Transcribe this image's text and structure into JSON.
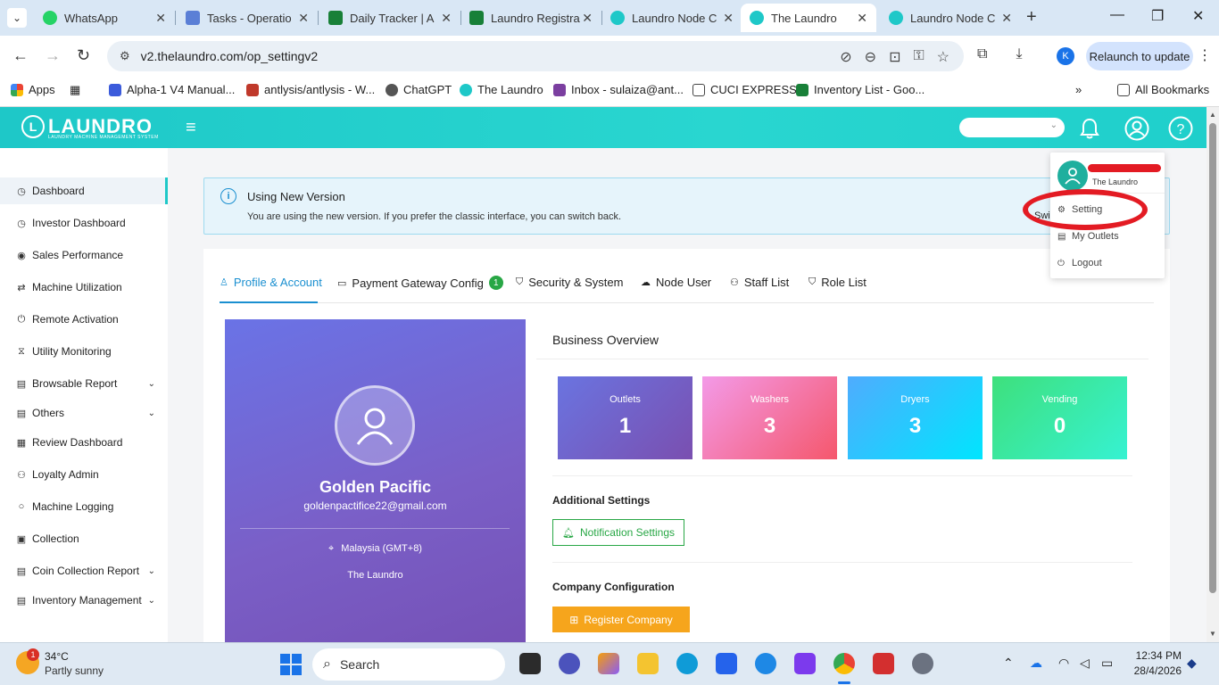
{
  "browser": {
    "tabs": [
      {
        "title": "WhatsApp",
        "color": "#25d366"
      },
      {
        "title": "Tasks - Operatio",
        "color": "#5b7fd6"
      },
      {
        "title": "Daily Tracker | A",
        "color": "#188038"
      },
      {
        "title": "Laundro Registra",
        "color": "#188038"
      },
      {
        "title": "Laundro Node C",
        "color": "#1ec8c8"
      },
      {
        "title": "The Laundro",
        "color": "#1ec8c8"
      },
      {
        "title": "Laundro Node C",
        "color": "#1ec8c8"
      }
    ],
    "url": "v2.thelaundro.com/op_settingv2",
    "relaunch_label": "Relaunch to update",
    "profile_letter": "K",
    "bookmarks": [
      {
        "label": "Apps"
      },
      {
        "label": "Alpha-1 V4 Manual..."
      },
      {
        "label": "antlysis/antlysis - W..."
      },
      {
        "label": "ChatGPT"
      },
      {
        "label": "The Laundro"
      },
      {
        "label": "Inbox - sulaiza@ant..."
      },
      {
        "label": "CUCI EXPRESS"
      },
      {
        "label": "Inventory List - Goo..."
      }
    ],
    "all_bookmarks": "All Bookmarks"
  },
  "app": {
    "logo_word": "LAUNDRO",
    "logo_sub": "LAUNDRY MACHINE MANAGEMENT SYSTEM",
    "sidebar": [
      {
        "label": "Dashboard",
        "icon": "◷"
      },
      {
        "label": "Investor Dashboard",
        "icon": "◷"
      },
      {
        "label": "Sales Performance",
        "icon": "◉"
      },
      {
        "label": "Machine Utilization",
        "icon": "⇄"
      },
      {
        "label": "Remote Activation",
        "icon": "⏻"
      },
      {
        "label": "Utility Monitoring",
        "icon": "⧖"
      },
      {
        "label": "Browsable Report",
        "icon": "▤"
      },
      {
        "label": "Others",
        "icon": "▤"
      },
      {
        "label": "Review Dashboard",
        "icon": "▦"
      },
      {
        "label": "Loyalty Admin",
        "icon": "⚇"
      },
      {
        "label": "Machine Logging",
        "icon": "○"
      },
      {
        "label": "Collection",
        "icon": "▣"
      },
      {
        "label": "Coin Collection Report",
        "icon": "▤"
      },
      {
        "label": "Inventory Management",
        "icon": "▤"
      }
    ],
    "notice": {
      "title": "Using New Version",
      "desc": "You are using the new version. If you prefer the classic interface, you can switch back.",
      "switch_partial": "Swi"
    },
    "tabs": [
      {
        "label": "Profile & Account"
      },
      {
        "label": "Payment Gateway Config",
        "badge": "1"
      },
      {
        "label": "Security & System"
      },
      {
        "label": "Node User"
      },
      {
        "label": "Staff List"
      },
      {
        "label": "Role List"
      }
    ],
    "profile": {
      "name": "Golden Pacific",
      "email": "goldenpactifice22@gmail.com",
      "timezone": "Malaysia (GMT+8)",
      "org": "The Laundro"
    },
    "business_overview": {
      "title": "Business Overview",
      "stats": [
        {
          "label": "Outlets",
          "value": "1"
        },
        {
          "label": "Washers",
          "value": "3"
        },
        {
          "label": "Dryers",
          "value": "3"
        },
        {
          "label": "Vending",
          "value": "0"
        }
      ]
    },
    "additional_settings": {
      "title": "Additional Settings",
      "button": "Notification Settings"
    },
    "company_config": {
      "title": "Company Configuration",
      "button": "Register Company"
    },
    "dropdown": {
      "org": "The Laundro",
      "items": [
        {
          "label": "Setting"
        },
        {
          "label": "My Outlets"
        },
        {
          "label": "Logout"
        }
      ]
    }
  },
  "taskbar": {
    "temp": "34°C",
    "weather": "Partly sunny",
    "weather_badge": "1",
    "search": "Search",
    "time": "12:34 PM",
    "date": "28/4/2026"
  }
}
